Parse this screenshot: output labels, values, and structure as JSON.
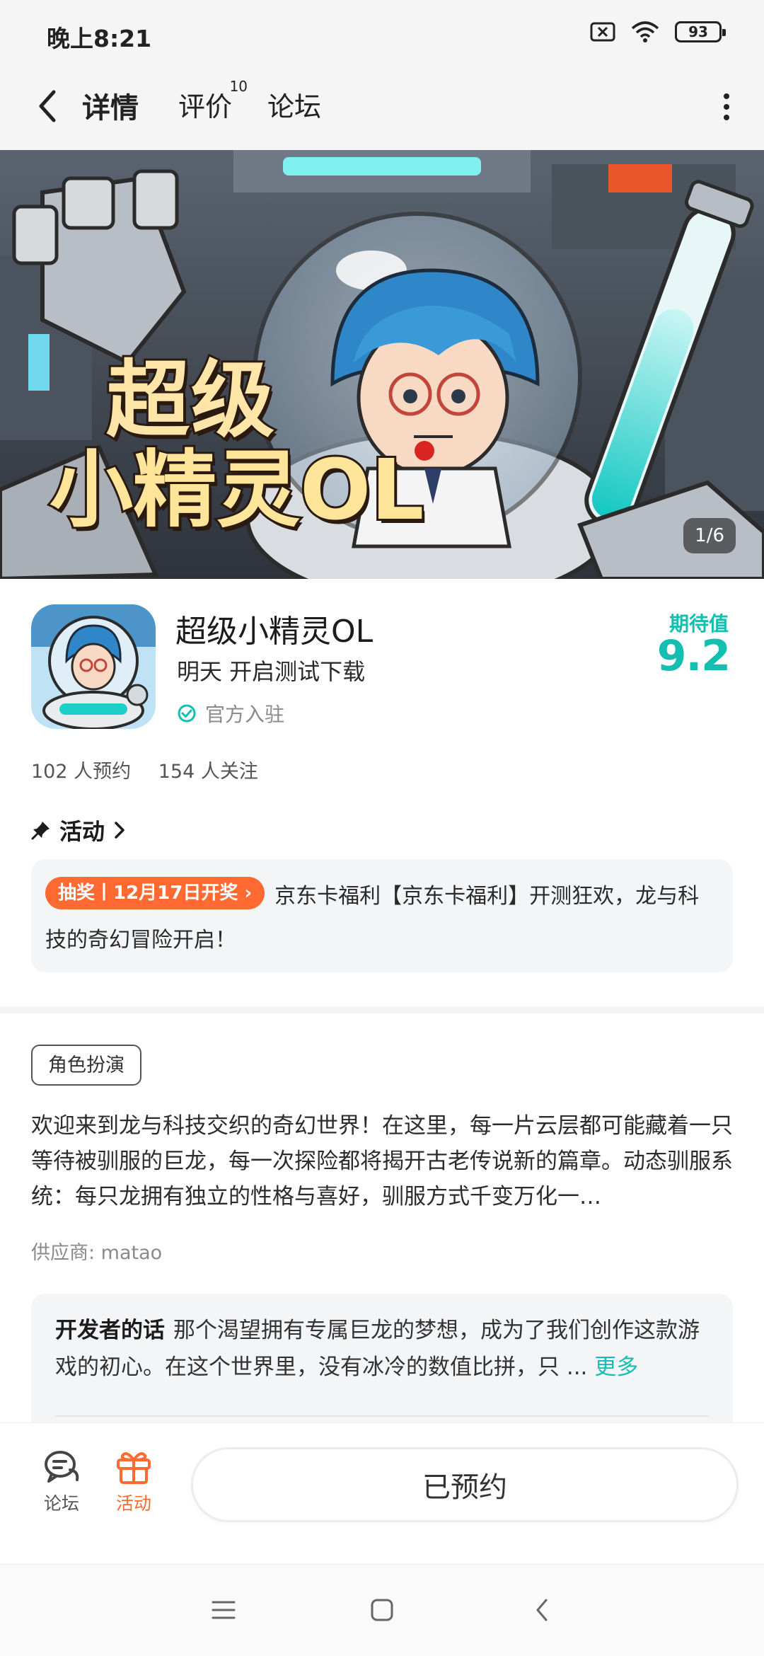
{
  "status_bar": {
    "time": "晚上8:21",
    "battery": "93"
  },
  "nav": {
    "tabs": [
      {
        "label": "详情",
        "active": true
      },
      {
        "label": "评价",
        "badge": "10"
      },
      {
        "label": "论坛"
      }
    ]
  },
  "banner": {
    "title_line1": "超级",
    "title_line2": "小精灵OL",
    "page_indicator": "1/6"
  },
  "app": {
    "name": "超级小精灵OL",
    "subtitle": "明天 开启测试下载",
    "official_label": "官方入驻",
    "expect_label": "期待值",
    "expect_value": "9.2",
    "reservations": "102 人预约",
    "followers": "154 人关注"
  },
  "activity": {
    "heading": "活动",
    "chip": "抽奖丨12月17日开奖",
    "text": "京东卡福利【京东卡福利】开测狂欢，龙与科技的奇幻冒险开启！"
  },
  "details": {
    "genre_tag": "角色扮演",
    "description": "欢迎来到龙与科技交织的奇幻世界！在这里，每一片云层都可能藏着一只等待被驯服的巨龙，每一次探险都将揭开古老传说新的篇章。动态驯服系统：每只龙拥有独立的性格与喜好，驯服方式千变万化一…",
    "provider": "供应商: matao",
    "dev_label": "开发者的话",
    "dev_text": "那个渴望拥有专属巨龙的梦想，成为了我们创作这款游戏的初心。在这个世界里，没有冰冷的数值比拼，只 ...",
    "dev_more": "更多"
  },
  "bottom_bar": {
    "forum_label": "论坛",
    "activity_label": "活动",
    "reserved_button": "已预约"
  },
  "colors": {
    "accent": "#14bfb1",
    "orange": "#ff6a33"
  }
}
